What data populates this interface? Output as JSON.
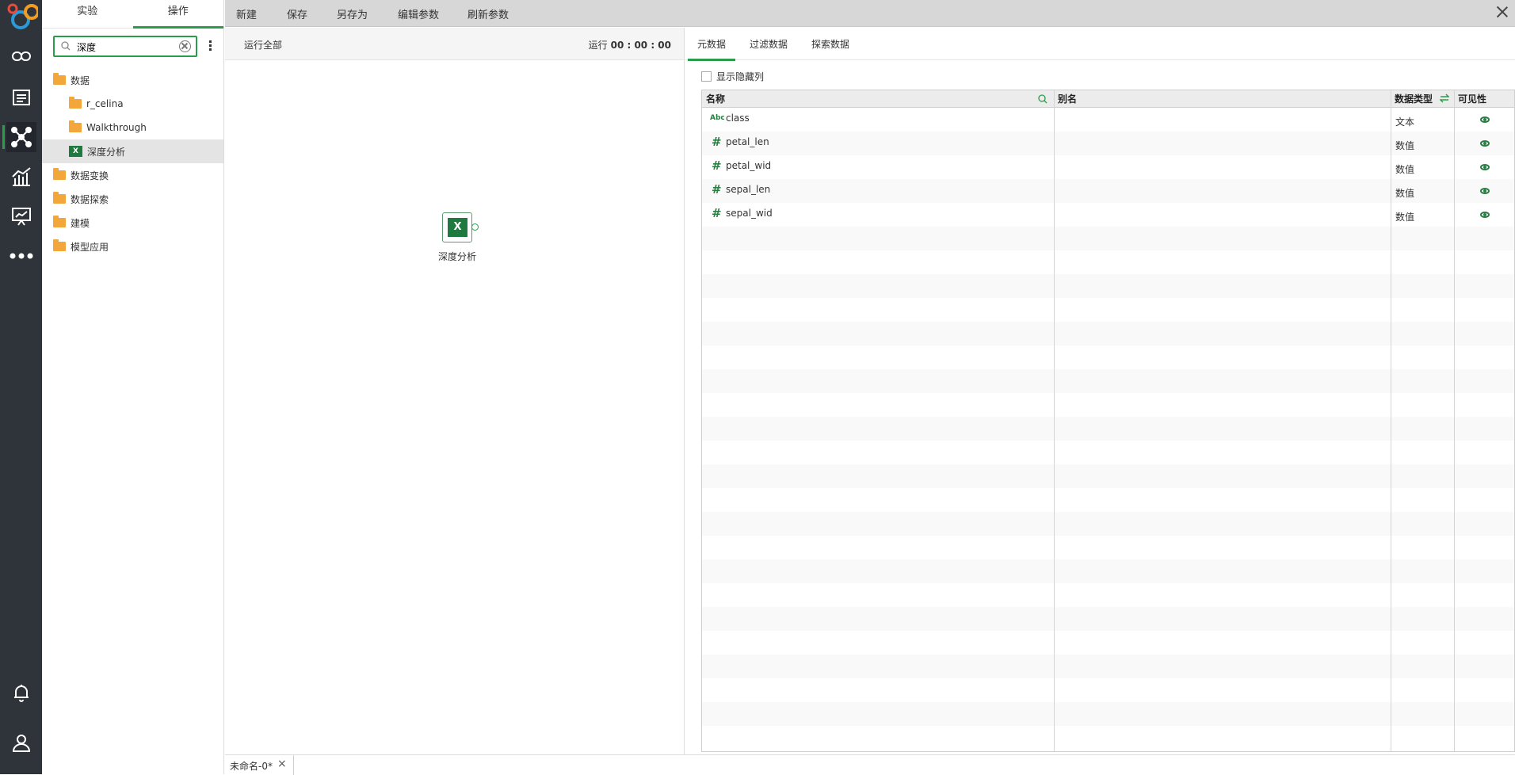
{
  "top_tabs": {
    "experiment": "实验",
    "operation": "操作"
  },
  "search": {
    "value": "深度"
  },
  "tree": {
    "items": [
      {
        "label": "数据"
      },
      {
        "label": "r_celina"
      },
      {
        "label": "Walkthrough"
      },
      {
        "label": "深度分析"
      },
      {
        "label": "数据变换"
      },
      {
        "label": "数据探索"
      },
      {
        "label": "建模"
      },
      {
        "label": "模型应用"
      }
    ]
  },
  "toolbar": {
    "new": "新建",
    "save": "保存",
    "save_as": "另存为",
    "edit_params": "编辑参数",
    "refresh_params": "刷新参数"
  },
  "canvas": {
    "run_all": "运行全部",
    "run_label": "运行",
    "run_time": "00 : 00 : 00",
    "node_label": "深度分析"
  },
  "doc_tab": {
    "label": "未命名-0*"
  },
  "meta": {
    "tabs": [
      "元数据",
      "过滤数据",
      "探索数据"
    ],
    "show_hidden": "显示隐藏列",
    "headers": {
      "name": "名称",
      "alias": "别名",
      "data_type": "数据类型",
      "visibility": "可见性"
    },
    "type_badge_text": "Abc",
    "type_badge_num": "#",
    "rows": [
      {
        "name": "class",
        "alias": "",
        "type": "文本"
      },
      {
        "name": "petal_len",
        "alias": "",
        "type": "数值"
      },
      {
        "name": "petal_wid",
        "alias": "",
        "type": "数值"
      },
      {
        "name": "sepal_len",
        "alias": "",
        "type": "数值"
      },
      {
        "name": "sepal_wid",
        "alias": "",
        "type": "数值"
      }
    ]
  },
  "colors": {
    "accent": "#2a9d4b",
    "rail_bg": "#2f343b",
    "folder": "#f3a63a",
    "excel": "#1f7a3f"
  }
}
